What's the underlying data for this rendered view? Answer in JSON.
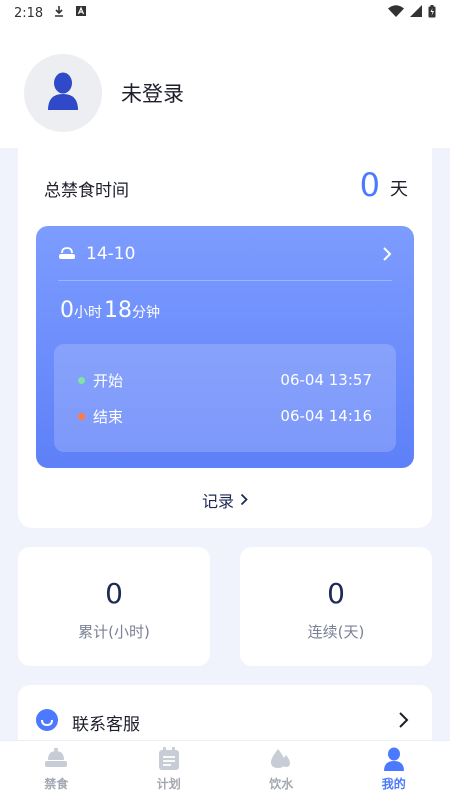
{
  "status_bar": {
    "time": "2:18"
  },
  "profile": {
    "username": "未登录"
  },
  "summary": {
    "label": "总禁食时间",
    "value": "0",
    "unit": "天"
  },
  "plan": {
    "name": "14-10",
    "elapsed": {
      "hours": "0",
      "hours_unit": "小时",
      "minutes": "18",
      "minutes_unit": "分钟"
    },
    "start": {
      "label": "开始",
      "value": "06-04 13:57"
    },
    "end": {
      "label": "结束",
      "value": "06-04 14:16"
    }
  },
  "record_link": "记录",
  "stats": [
    {
      "value": "0",
      "label": "累计(小时)"
    },
    {
      "value": "0",
      "label": "连续(天)"
    }
  ],
  "contact": {
    "label": "联系客服"
  },
  "tabs": [
    {
      "label": "禁食",
      "icon": "fasting-icon"
    },
    {
      "label": "计划",
      "icon": "plan-icon"
    },
    {
      "label": "饮水",
      "icon": "water-drop-icon"
    },
    {
      "label": "我的",
      "icon": "profile-icon"
    }
  ],
  "colors": {
    "accent": "#4b79ff",
    "card_gradient_top": "#7d9cff",
    "card_gradient_bottom": "#5e80f8",
    "start_dot": "#7fe59e",
    "end_dot": "#ff7a45"
  }
}
